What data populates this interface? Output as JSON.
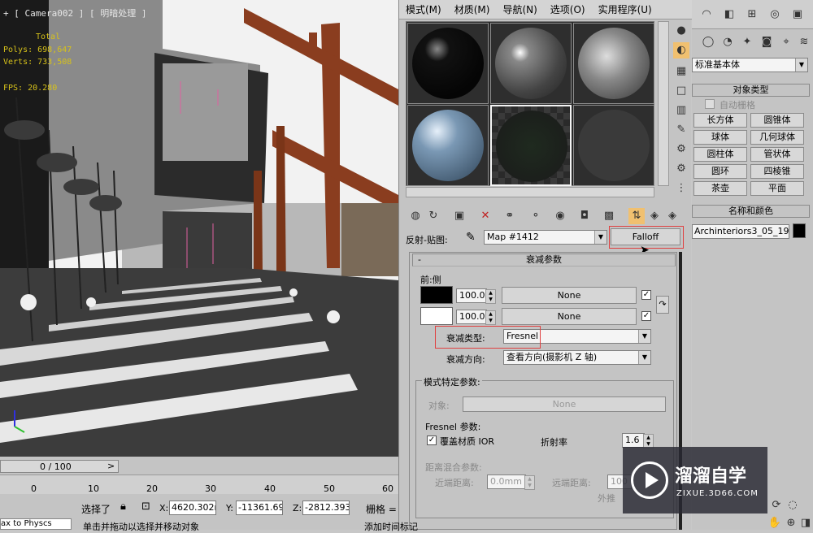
{
  "viewport": {
    "label": "+ [ Camera002 ] [ 明暗处理 ]",
    "stats": {
      "total": "Total",
      "polys": "Polys: 698,647",
      "verts": "Verts: 733,508",
      "fps": "FPS:  20.280"
    }
  },
  "material_editor": {
    "menu": [
      "模式(M)",
      "材质(M)",
      "导航(N)",
      "选项(O)",
      "实用程序(U)"
    ],
    "slots": [
      {
        "name": "black-gloss",
        "color": "#0a0a0a"
      },
      {
        "name": "grey-gloss",
        "color": "#707070"
      },
      {
        "name": "stone",
        "color": "#9a9a9a"
      },
      {
        "name": "blue-glass",
        "color": "#6f8aa3"
      },
      {
        "name": "checker",
        "color": "#333333"
      },
      {
        "name": "empty",
        "color": "#3a3a3a"
      }
    ],
    "map_row": {
      "label": "反射-贴图:",
      "map_name": "Map #1412",
      "type_button": "Falloff"
    },
    "falloff_params": {
      "header": "衰减参数",
      "front_side": "前:侧",
      "row1": {
        "value": "100.0",
        "map": "None"
      },
      "row2": {
        "value": "100.0",
        "map": "None"
      },
      "falloff_type_label": "衰减类型:",
      "falloff_type_value": "Fresnel",
      "falloff_dir_label": "衰减方向:",
      "falloff_dir_value": "查看方向(摄影机 Z 轴)"
    },
    "mode_params": {
      "header": "模式特定参数:",
      "object_label": "对象:",
      "object_value": "None",
      "fresnel_label": "Fresnel 参数:",
      "override_ior": "覆盖材质 IOR",
      "ior_label": "折射率",
      "ior_value": "1.6",
      "distance_blend": "距离混合参数:",
      "near_label": "近端距离:",
      "near_value": "0.0mm",
      "far_label": "远端距离:",
      "far_value": "100",
      "extrapolate": "外推"
    }
  },
  "command_panel": {
    "category": "标准基本体",
    "object_type_header": "对象类型",
    "autogrid": "自动栅格",
    "buttons": [
      "长方体",
      "圆锥体",
      "球体",
      "几何球体",
      "圆柱体",
      "管状体",
      "圆环",
      "四棱锥",
      "茶壶",
      "平面"
    ],
    "name_color_header": "名称和颜色",
    "object_name": "Archinteriors3_05_195"
  },
  "timeline": {
    "frame": "0 / 100",
    "ticks": [
      "0",
      "10",
      "20",
      "30",
      "40",
      "50",
      "60"
    ]
  },
  "status": {
    "selection": "选择了",
    "x_label": "X:",
    "x_value": "4620.302m",
    "y_label": "Y:",
    "y_value": "-11361.69",
    "z_label": "Z:",
    "z_value": "-2812.393",
    "grid": "栅格 =",
    "prompt": "单击并拖动以选择并移动对象",
    "maxscript": "ax to Physcs",
    "add_time_tag": "添加时间标记"
  },
  "watermark": {
    "title": "溜溜自学",
    "url": "ZIXUE.3D66.COM"
  }
}
